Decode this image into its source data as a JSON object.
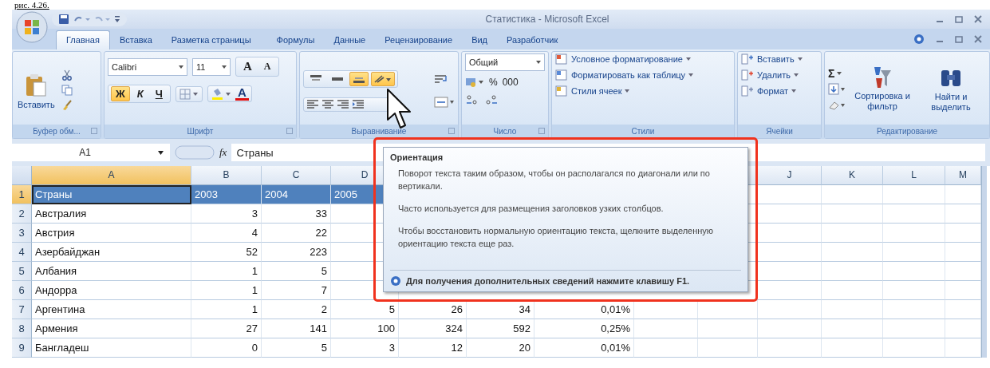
{
  "caption": "рис. 4.26.",
  "window": {
    "title": "Статистика - Microsoft Excel"
  },
  "tabs": [
    {
      "label": "Главная",
      "selected": true
    },
    {
      "label": "Вставка",
      "selected": false
    },
    {
      "label": "Разметка страницы",
      "selected": false
    },
    {
      "label": "Формулы",
      "selected": false
    },
    {
      "label": "Данные",
      "selected": false
    },
    {
      "label": "Рецензирование",
      "selected": false
    },
    {
      "label": "Вид",
      "selected": false
    },
    {
      "label": "Разработчик",
      "selected": false
    }
  ],
  "ribbon": {
    "clipboard": {
      "label": "Буфер обм...",
      "paste": "Вставить"
    },
    "font": {
      "label": "Шрифт",
      "name": "Calibri",
      "size": "11",
      "grow": "A",
      "shrink": "A",
      "color_letter": "A",
      "styles": [
        {
          "label": "Ж",
          "selected": true
        },
        {
          "label": "К",
          "selected": false
        },
        {
          "label": "Ч",
          "selected": false
        }
      ]
    },
    "alignment": {
      "label": "Выравнивание",
      "buttons": [
        {
          "kind": "top",
          "selected": false
        },
        {
          "kind": "middle",
          "selected": false
        },
        {
          "kind": "bottom",
          "selected": true
        },
        {
          "kind": "orientation",
          "selected": true
        }
      ]
    },
    "number": {
      "label": "Число",
      "format": "Общий",
      "percent": "%",
      "thousands": "000"
    },
    "styles": {
      "label": "Стили",
      "items": [
        "Условное форматирование",
        "Форматировать как таблицу",
        "Стили ячеек"
      ]
    },
    "cells": {
      "label": "Ячейки",
      "items": [
        "Вставить",
        "Удалить",
        "Формат"
      ]
    },
    "editing": {
      "label": "Редактирование",
      "sum": "Σ",
      "sort": "Сортировка и фильтр",
      "find": "Найти и выделить"
    }
  },
  "formula_bar": {
    "cell": "A1",
    "function_label": "fx",
    "value": "Страны"
  },
  "columns": [
    {
      "label": "A",
      "selected": true
    },
    {
      "label": "B",
      "selected": false
    },
    {
      "label": "C",
      "selected": false
    },
    {
      "label": "D",
      "selected": false
    }
  ],
  "columns_right": [
    {
      "label": "J",
      "selected": false
    },
    {
      "label": "K",
      "selected": false
    },
    {
      "label": "L",
      "selected": false
    },
    {
      "label": "M",
      "selected": false
    }
  ],
  "rows": [
    {
      "number": "1",
      "kind": "header",
      "selected": true,
      "cells": [
        "Страны",
        "2003",
        "2004",
        "2005"
      ]
    },
    {
      "number": "2",
      "kind": "data",
      "selected": false,
      "cells": [
        "Австралия",
        "3",
        "33"
      ]
    },
    {
      "number": "3",
      "kind": "data",
      "selected": false,
      "cells": [
        "Австрия",
        "4",
        "22"
      ]
    },
    {
      "number": "4",
      "kind": "data",
      "selected": false,
      "cells": [
        "Азербайджан",
        "52",
        "223"
      ]
    },
    {
      "number": "5",
      "kind": "data",
      "selected": false,
      "cells": [
        "Албания",
        "1",
        "5"
      ]
    },
    {
      "number": "6",
      "kind": "data",
      "selected": false,
      "cells": [
        "Андорра",
        "1",
        "7"
      ]
    },
    {
      "number": "7",
      "kind": "data",
      "selected": false,
      "cells": [
        "Аргентина",
        "1",
        "2",
        "5",
        "26",
        "34",
        "0,01%"
      ]
    },
    {
      "number": "8",
      "kind": "data",
      "selected": false,
      "cells": [
        "Армения",
        "27",
        "141",
        "100",
        "324",
        "592",
        "0,25%"
      ]
    },
    {
      "number": "9",
      "kind": "data",
      "selected": false,
      "cells": [
        "Бангладеш",
        "0",
        "5",
        "3",
        "12",
        "20",
        "0,01%"
      ]
    }
  ],
  "tooltip": {
    "title": "Ориентация",
    "paragraphs": [
      "Поворот текста таким образом, чтобы он располагался по диагонали или по вертикали.",
      "Часто используется для размещения заголовков узких столбцов.",
      "Чтобы восстановить нормальную ориентацию текста, щелкните выделенную ориентацию текста еще раз."
    ],
    "help": "Для получения дополнительных сведений нажмите клавишу F1."
  }
}
